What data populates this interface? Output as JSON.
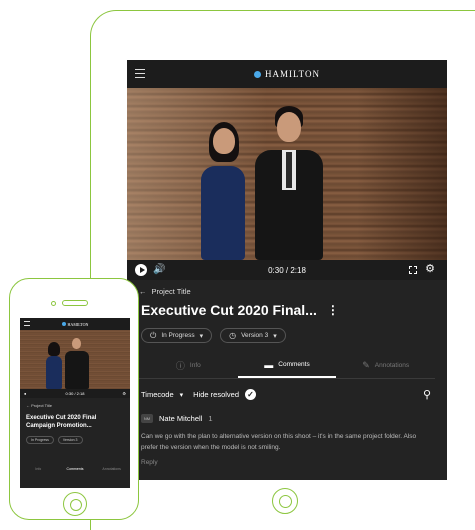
{
  "app": {
    "brand": "HAMILTON"
  },
  "player": {
    "time": "0:30 / 2:18"
  },
  "project": {
    "back_label": "Project Title",
    "title": "Executive Cut 2020 Final...",
    "mobile_title": "Executive Cut 2020 Final Campaign Promotion..."
  },
  "chips": [
    {
      "label": "In Progress"
    },
    {
      "label": "Version 3"
    }
  ],
  "tabs": [
    {
      "label": "Info"
    },
    {
      "label": "Comments"
    },
    {
      "label": "Annotations"
    }
  ],
  "filters": {
    "timecode": "Timecode",
    "hide_resolved": "Hide resolved"
  },
  "comment": {
    "author": "Nate Mitchell",
    "count": "1",
    "text": "Can we go with the plan to alternative version on this shoot – it's in the same project folder. Also prefer the version when the model is not smiling.",
    "reply_label": "Reply"
  },
  "mobile_tabs": [
    {
      "label": "Info"
    },
    {
      "label": "Comments"
    },
    {
      "label": "Annotations"
    }
  ],
  "colors": {
    "device_outline": "#8cc63f",
    "screen_bg": "#232323",
    "brand_dot": "#4aa8e8"
  }
}
